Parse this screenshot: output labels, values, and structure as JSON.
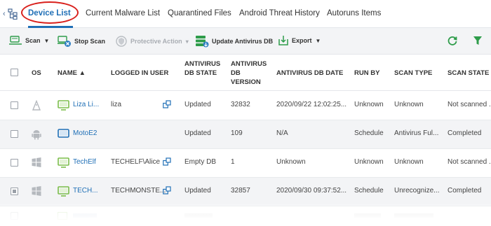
{
  "tabs": [
    {
      "label": "Device List",
      "active": true
    },
    {
      "label": "Current Malware List",
      "active": false
    },
    {
      "label": "Quarantined Files",
      "active": false
    },
    {
      "label": "Android Threat History",
      "active": false
    },
    {
      "label": "Autoruns Items",
      "active": false
    }
  ],
  "toolbar": {
    "scan": "Scan",
    "stop_scan": "Stop Scan",
    "protective_action": "Protective Action",
    "update_db": "Update Antivirus DB",
    "export": "Export"
  },
  "columns": {
    "os": "OS",
    "name": "NAME ▲",
    "logged_in_user": "LOGGED IN USER",
    "db_state": "ANTIVIRUS\nDB STATE",
    "db_version": "ANTIVIRUS\nDB\nVERSION",
    "db_date": "ANTIVIRUS DB DATE",
    "run_by": "RUN BY",
    "scan_type": "SCAN TYPE",
    "scan_state": "SCAN STATE"
  },
  "rows": [
    {
      "os": "linux-icon",
      "device_icon": "workstation-icon",
      "name": "Liza Li...",
      "user": "liza",
      "db_state": "Updated",
      "db_version": "32832",
      "db_date": "2020/09/22 12:02:25...",
      "run_by": "Unknown",
      "scan_type": "Unknown",
      "scan_state": "Not scanned ...",
      "checked": false,
      "highlight": false
    },
    {
      "os": "android-icon",
      "device_icon": "tablet-icon",
      "name": "MotoE2",
      "user": "",
      "db_state": "Updated",
      "db_version": "109",
      "db_date": "N/A",
      "run_by": "Schedule",
      "scan_type": "Antivirus Ful...",
      "scan_state": "Completed",
      "checked": false,
      "highlight": true
    },
    {
      "os": "windows-icon",
      "device_icon": "workstation-icon",
      "name": "TechElf",
      "user": "TECHELF\\Alice",
      "db_state": "Empty DB",
      "db_version": "1",
      "db_date": "Unknown",
      "run_by": "Unknown",
      "scan_type": "Unknown",
      "scan_state": "Not scanned ...",
      "checked": false,
      "highlight": false
    },
    {
      "os": "windows-icon",
      "device_icon": "workstation-icon",
      "name": "TECH...",
      "user": "TECHMONSTE...",
      "db_state": "Updated",
      "db_version": "32857",
      "db_date": "2020/09/30 09:37:52...",
      "run_by": "Schedule",
      "scan_type": "Unrecognize...",
      "scan_state": "Completed",
      "checked": true,
      "highlight": true
    }
  ],
  "colors": {
    "accent": "#1f6fb6",
    "highlight_circle": "#d9201c",
    "toolbar_bg": "#f3f4f6",
    "refresh": "#2e9c4a",
    "filter": "#2e9c4a"
  }
}
